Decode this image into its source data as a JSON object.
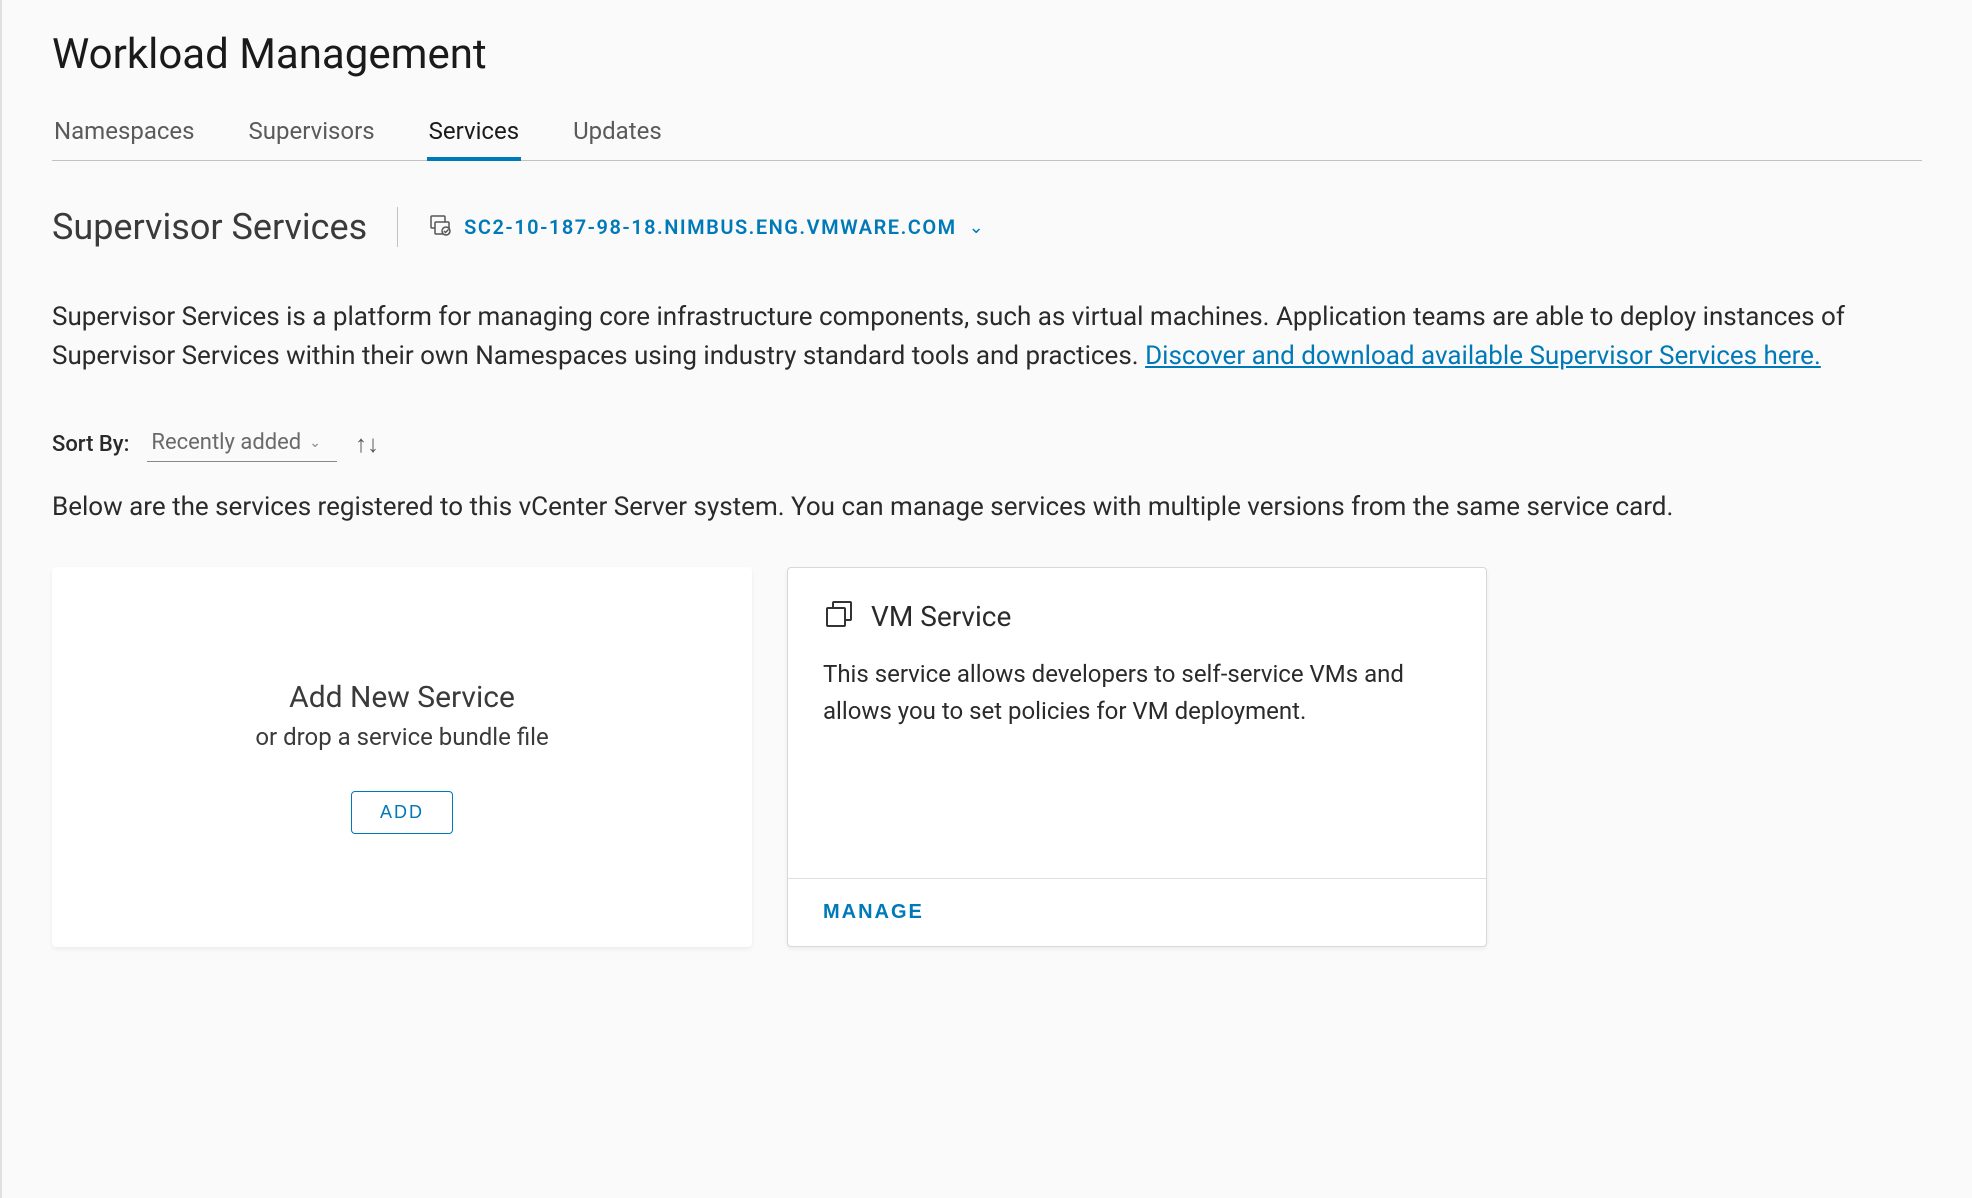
{
  "page_title": "Workload Management",
  "tabs": [
    {
      "label": "Namespaces",
      "active": false
    },
    {
      "label": "Supervisors",
      "active": false
    },
    {
      "label": "Services",
      "active": true
    },
    {
      "label": "Updates",
      "active": false
    }
  ],
  "section": {
    "title": "Supervisor Services",
    "host": "SC2-10-187-98-18.NIMBUS.ENG.VMWARE.COM",
    "description_text": "Supervisor Services is a platform for managing core infrastructure components, such as virtual machines. Application teams are able to deploy instances of Supervisor Services within their own Namespaces using industry standard tools and practices. ",
    "description_link": "Discover and download available Supervisor Services here."
  },
  "sort": {
    "label": "Sort By:",
    "selected": "Recently added"
  },
  "subdescription": "Below are the services registered to this vCenter Server system. You can manage services with multiple versions from the same service card.",
  "add_card": {
    "title": "Add New Service",
    "subtitle": "or drop a service bundle file",
    "button": "ADD"
  },
  "service_card": {
    "name": "VM Service",
    "description": "This service allows developers to self-service VMs and allows you to set policies for VM deployment.",
    "manage": "MANAGE"
  }
}
